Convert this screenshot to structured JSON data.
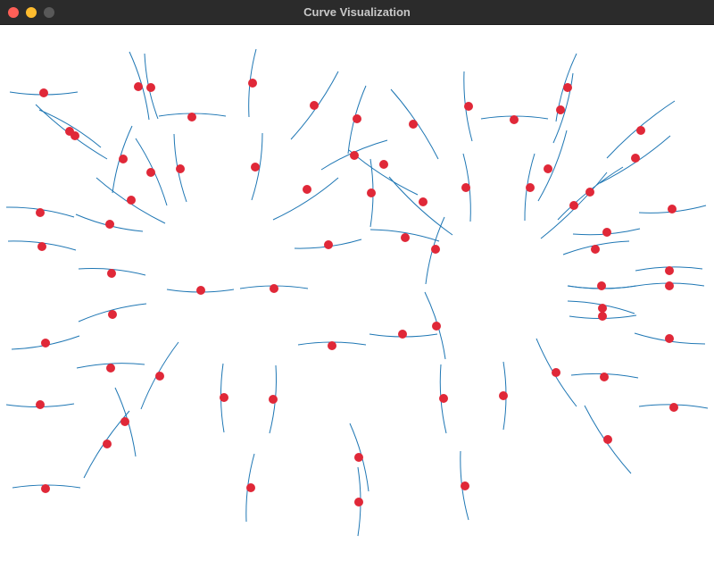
{
  "window": {
    "title": "Curve Visualization"
  },
  "plot": {
    "curve_color": "#1f77b4",
    "point_color": "#e02838",
    "markers": "ring-of-points-with-short-curve-segments"
  },
  "chart_data": {
    "type": "scatter",
    "title": "",
    "xlabel": "",
    "ylabel": "",
    "grid": false,
    "points": [
      [
        49,
        104
      ],
      [
        155,
        97
      ],
      [
        169,
        98
      ],
      [
        215,
        131
      ],
      [
        283,
        93
      ],
      [
        352,
        118
      ],
      [
        400,
        133
      ],
      [
        463,
        139
      ],
      [
        525,
        119
      ],
      [
        576,
        134
      ],
      [
        636,
        98
      ],
      [
        628,
        123
      ],
      [
        718,
        146
      ],
      [
        712,
        177
      ],
      [
        753,
        234
      ],
      [
        750,
        303
      ],
      [
        750,
        320
      ],
      [
        750,
        379
      ],
      [
        755,
        456
      ],
      [
        78,
        147
      ],
      [
        84,
        152
      ],
      [
        138,
        178
      ],
      [
        169,
        193
      ],
      [
        202,
        189
      ],
      [
        286,
        187
      ],
      [
        344,
        212
      ],
      [
        397,
        174
      ],
      [
        430,
        184
      ],
      [
        416,
        216
      ],
      [
        474,
        226
      ],
      [
        522,
        210
      ],
      [
        594,
        210
      ],
      [
        614,
        189
      ],
      [
        661,
        215
      ],
      [
        643,
        230
      ],
      [
        680,
        260
      ],
      [
        667,
        279
      ],
      [
        674,
        320
      ],
      [
        675,
        345
      ],
      [
        675,
        354
      ],
      [
        45,
        238
      ],
      [
        123,
        251
      ],
      [
        47,
        276
      ],
      [
        147,
        224
      ],
      [
        125,
        306
      ],
      [
        225,
        325
      ],
      [
        307,
        323
      ],
      [
        368,
        274
      ],
      [
        454,
        266
      ],
      [
        488,
        279
      ],
      [
        126,
        352
      ],
      [
        51,
        384
      ],
      [
        124,
        412
      ],
      [
        179,
        421
      ],
      [
        372,
        387
      ],
      [
        451,
        374
      ],
      [
        489,
        365
      ],
      [
        251,
        445
      ],
      [
        306,
        447
      ],
      [
        497,
        446
      ],
      [
        564,
        443
      ],
      [
        623,
        417
      ],
      [
        677,
        422
      ],
      [
        45,
        453
      ],
      [
        140,
        472
      ],
      [
        120,
        497
      ],
      [
        402,
        512
      ],
      [
        681,
        492
      ],
      [
        51,
        547
      ],
      [
        281,
        546
      ],
      [
        402,
        562
      ],
      [
        521,
        544
      ]
    ],
    "segments": [
      [
        [
          11,
          103
        ],
        [
          87,
          103
        ]
      ],
      [
        [
          145,
          58
        ],
        [
          167,
          134
        ]
      ],
      [
        [
          162,
          60
        ],
        [
          177,
          133
        ]
      ],
      [
        [
          178,
          130
        ],
        [
          253,
          130
        ]
      ],
      [
        [
          287,
          55
        ],
        [
          279,
          131
        ]
      ],
      [
        [
          379,
          80
        ],
        [
          326,
          156
        ]
      ],
      [
        [
          410,
          96
        ],
        [
          390,
          172
        ]
      ],
      [
        [
          438,
          100
        ],
        [
          491,
          178
        ]
      ],
      [
        [
          520,
          80
        ],
        [
          529,
          158
        ]
      ],
      [
        [
          539,
          133
        ],
        [
          614,
          133
        ]
      ],
      [
        [
          646,
          60
        ],
        [
          623,
          136
        ]
      ],
      [
        [
          642,
          82
        ],
        [
          620,
          160
        ]
      ],
      [
        [
          756,
          113
        ],
        [
          680,
          177
        ]
      ],
      [
        [
          751,
          152
        ],
        [
          672,
          205
        ]
      ],
      [
        [
          716,
          238
        ],
        [
          791,
          230
        ]
      ],
      [
        [
          712,
          303
        ],
        [
          787,
          301
        ]
      ],
      [
        [
          636,
          320
        ],
        [
          713,
          320
        ]
      ],
      [
        [
          713,
          320
        ],
        [
          789,
          320
        ]
      ],
      [
        [
          711,
          373
        ],
        [
          790,
          385
        ]
      ],
      [
        [
          716,
          455
        ],
        [
          793,
          457
        ]
      ],
      [
        [
          40,
          117
        ],
        [
          120,
          178
        ]
      ],
      [
        [
          44,
          123
        ],
        [
          113,
          165
        ]
      ],
      [
        [
          148,
          141
        ],
        [
          126,
          216
        ]
      ],
      [
        [
          152,
          155
        ],
        [
          187,
          230
        ]
      ],
      [
        [
          195,
          150
        ],
        [
          209,
          226
        ]
      ],
      [
        [
          294,
          149
        ],
        [
          282,
          224
        ]
      ],
      [
        [
          306,
          246
        ],
        [
          379,
          199
        ]
      ],
      [
        [
          360,
          190
        ],
        [
          434,
          157
        ]
      ],
      [
        [
          391,
          168
        ],
        [
          468,
          218
        ]
      ],
      [
        [
          415,
          178
        ],
        [
          415,
          254
        ]
      ],
      [
        [
          436,
          198
        ],
        [
          507,
          263
        ]
      ],
      [
        [
          519,
          172
        ],
        [
          527,
          248
        ]
      ],
      [
        [
          599,
          172
        ],
        [
          588,
          247
        ]
      ],
      [
        [
          635,
          146
        ],
        [
          603,
          225
        ]
      ],
      [
        [
          698,
          187
        ],
        [
          625,
          246
        ]
      ],
      [
        [
          680,
          193
        ],
        [
          606,
          267
        ]
      ],
      [
        [
          642,
          262
        ],
        [
          717,
          256
        ]
      ],
      [
        [
          631,
          285
        ],
        [
          705,
          270
        ]
      ],
      [
        [
          636,
          320
        ],
        [
          713,
          320
        ]
      ],
      [
        [
          636,
          337
        ],
        [
          711,
          351
        ]
      ],
      [
        [
          638,
          354
        ],
        [
          713,
          353
        ]
      ],
      [
        [
          7,
          232
        ],
        [
          83,
          243
        ]
      ],
      [
        [
          85,
          240
        ],
        [
          160,
          259
        ]
      ],
      [
        [
          9,
          270
        ],
        [
          85,
          280
        ]
      ],
      [
        [
          108,
          199
        ],
        [
          185,
          250
        ]
      ],
      [
        [
          88,
          301
        ],
        [
          163,
          308
        ]
      ],
      [
        [
          187,
          324
        ],
        [
          262,
          324
        ]
      ],
      [
        [
          269,
          323
        ],
        [
          345,
          323
        ]
      ],
      [
        [
          330,
          278
        ],
        [
          405,
          268
        ]
      ],
      [
        [
          415,
          257
        ],
        [
          492,
          270
        ]
      ],
      [
        [
          498,
          243
        ],
        [
          477,
          318
        ]
      ],
      [
        [
          88,
          360
        ],
        [
          164,
          340
        ]
      ],
      [
        [
          13,
          391
        ],
        [
          89,
          376
        ]
      ],
      [
        [
          86,
          412
        ],
        [
          162,
          408
        ]
      ],
      [
        [
          200,
          383
        ],
        [
          158,
          458
        ]
      ],
      [
        [
          334,
          386
        ],
        [
          410,
          386
        ]
      ],
      [
        [
          414,
          374
        ],
        [
          490,
          374
        ]
      ],
      [
        [
          476,
          327
        ],
        [
          499,
          402
        ]
      ],
      [
        [
          250,
          407
        ],
        [
          251,
          484
        ]
      ],
      [
        [
          309,
          409
        ],
        [
          302,
          485
        ]
      ],
      [
        [
          494,
          408
        ],
        [
          500,
          485
        ]
      ],
      [
        [
          564,
          405
        ],
        [
          564,
          481
        ]
      ],
      [
        [
          601,
          379
        ],
        [
          646,
          455
        ]
      ],
      [
        [
          640,
          420
        ],
        [
          715,
          423
        ]
      ],
      [
        [
          7,
          453
        ],
        [
          83,
          452
        ]
      ],
      [
        [
          129,
          434
        ],
        [
          152,
          511
        ]
      ],
      [
        [
          145,
          460
        ],
        [
          94,
          535
        ]
      ],
      [
        [
          392,
          474
        ],
        [
          413,
          550
        ]
      ],
      [
        [
          655,
          454
        ],
        [
          707,
          530
        ]
      ],
      [
        [
          14,
          546
        ],
        [
          90,
          546
        ]
      ],
      [
        [
          285,
          508
        ],
        [
          276,
          584
        ]
      ],
      [
        [
          401,
          523
        ],
        [
          401,
          600
        ]
      ],
      [
        [
          516,
          505
        ],
        [
          525,
          582
        ]
      ]
    ]
  }
}
